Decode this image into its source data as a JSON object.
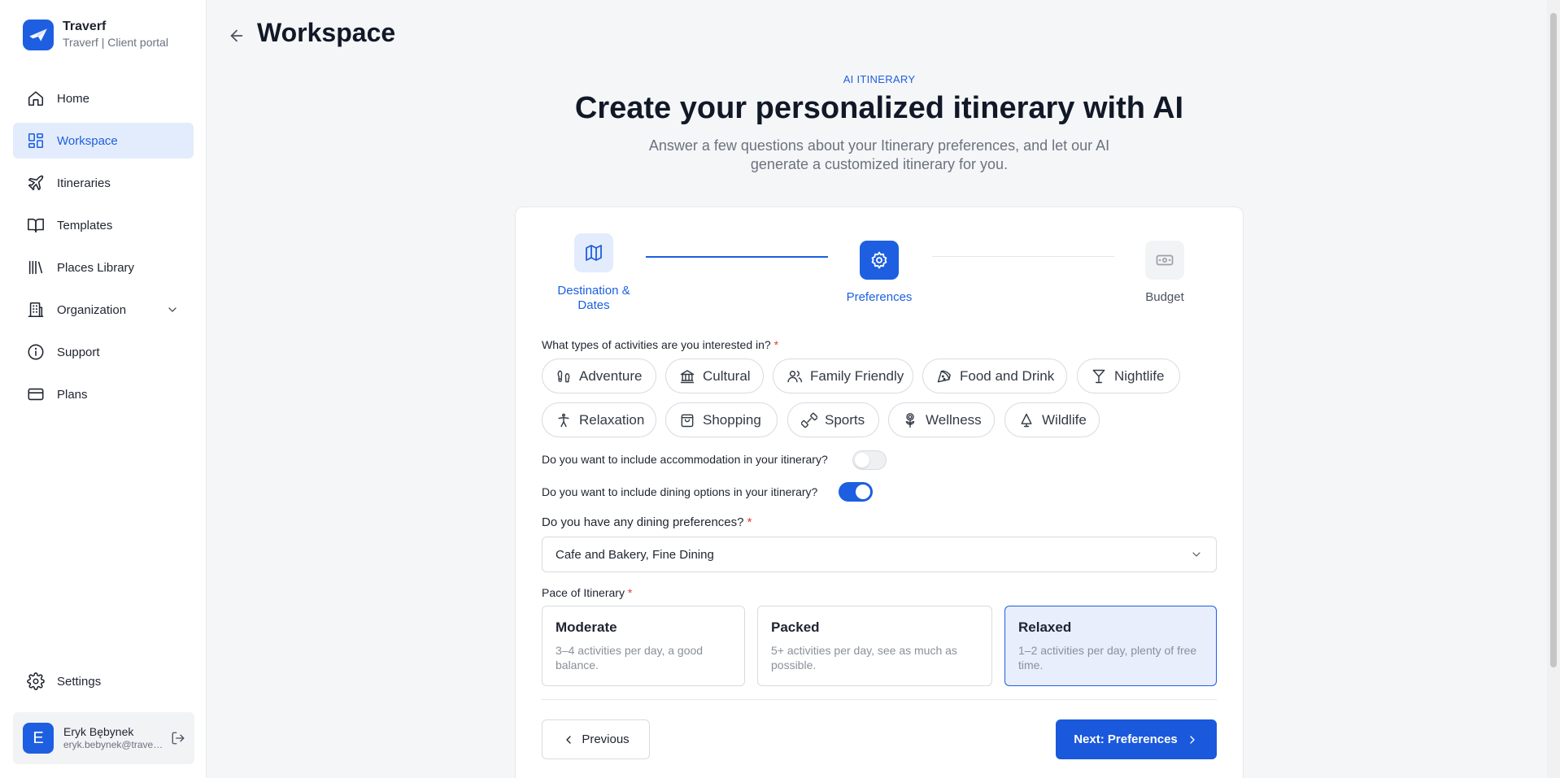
{
  "sidebar": {
    "brand": {
      "name": "Traverf",
      "subtitle": "Traverf | Client portal"
    },
    "nav": [
      {
        "label": "Home",
        "icon": "home-icon"
      },
      {
        "label": "Workspace",
        "icon": "grid-icon",
        "active": true
      },
      {
        "label": "Itineraries",
        "icon": "plane-icon"
      },
      {
        "label": "Templates",
        "icon": "book-icon"
      },
      {
        "label": "Places Library",
        "icon": "library-icon"
      },
      {
        "label": "Organization",
        "icon": "building-icon"
      },
      {
        "label": "Support",
        "icon": "info-icon"
      },
      {
        "label": "Plans",
        "icon": "credit-card-icon"
      }
    ],
    "settings": {
      "label": "Settings",
      "icon": "gear-icon"
    },
    "user": {
      "initial": "E",
      "name": "Eryk Bębynek",
      "email": "eryk.bebynek@traverf.com"
    }
  },
  "header": {
    "title": "Workspace"
  },
  "hero": {
    "eyebrow": "AI ITINERARY",
    "title": "Create your personalized itinerary with AI",
    "subtitle": "Answer a few questions about your Itinerary preferences, and let our AI generate a customized itinerary for you."
  },
  "stepper": {
    "steps": [
      {
        "label": "Destination & Dates",
        "state": "completed"
      },
      {
        "label": "Preferences",
        "state": "current"
      },
      {
        "label": "Budget",
        "state": "upcoming"
      }
    ]
  },
  "form": {
    "activities_question": "What types of activities are you interested in?",
    "activities": [
      "Adventure",
      "Cultural",
      "Family Friendly",
      "Food and Drink",
      "Nightlife",
      "Relaxation",
      "Shopping",
      "Sports",
      "Wellness",
      "Wildlife"
    ],
    "accommodation_question": "Do you want to include accommodation in your itinerary?",
    "accommodation_enabled": false,
    "dining_question": "Do you want to include dining options in your itinerary?",
    "dining_enabled": true,
    "dining_pref_question": "Do you have any dining preferences?",
    "dining_pref_value": "Cafe and Bakery, Fine Dining",
    "pace_question": "Pace of Itinerary",
    "pace_options": [
      {
        "title": "Moderate",
        "desc": "3–4 activities per day, a good balance."
      },
      {
        "title": "Packed",
        "desc": "5+ activities per day, see as much as possible."
      },
      {
        "title": "Relaxed",
        "desc": "1–2 activities per day, plenty of free time.",
        "selected": true
      }
    ],
    "required_mark": "*"
  },
  "buttons": {
    "previous": "Previous",
    "next": "Next: Preferences"
  },
  "colors": {
    "accent": "#1d5fe0",
    "active_bg": "#e3ecfd",
    "required": "#e23b3b"
  }
}
